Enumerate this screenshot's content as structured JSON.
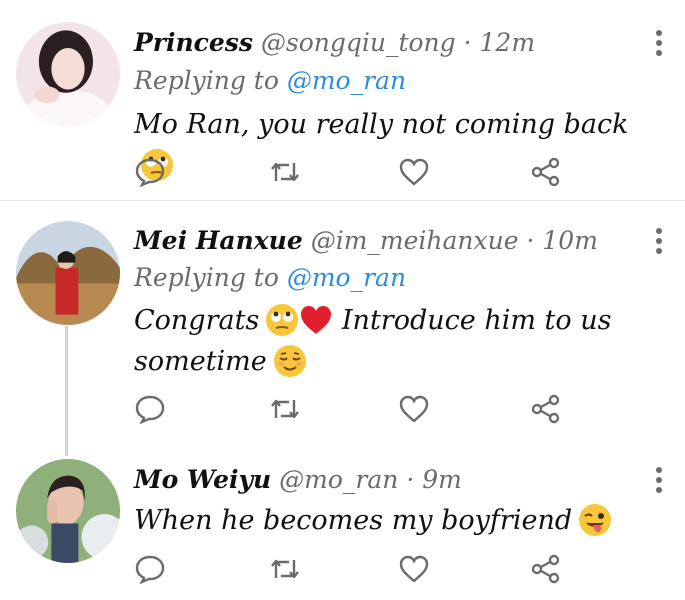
{
  "tweets": [
    {
      "name": "Princess",
      "handle": "@songqiu_tong",
      "separator": "·",
      "time": "12m",
      "reply_prefix": "Replying to",
      "reply_to": "@mo_ran",
      "text": "Mo Ran, you really not coming back",
      "emojis": [
        "rolling-eyes-emoji"
      ]
    },
    {
      "name": "Mei Hanxue",
      "handle": "@im_meihanxue",
      "separator": "·",
      "time": "10m",
      "reply_prefix": "Replying to",
      "reply_to": "@mo_ran",
      "text_1": "Congrats",
      "text_2": "Introduce him to us",
      "text_3": "sometime",
      "emojis": [
        "rolling-eyes-emoji",
        "red-heart-emoji",
        "relieved-face-emoji"
      ]
    },
    {
      "name": "Mo Weiyu",
      "handle": "@mo_ran",
      "separator": "·",
      "time": "9m",
      "text": "When he becomes my boyfriend",
      "emojis": [
        "winking-tongue-emoji"
      ]
    }
  ],
  "actions": [
    "reply-icon",
    "retweet-icon",
    "like-icon",
    "share-icon"
  ],
  "colors": {
    "mention": "#2a8fd8",
    "muted": "#6b6b6b",
    "icon": "#6b6b6b",
    "divider": "#e3e3e3"
  }
}
